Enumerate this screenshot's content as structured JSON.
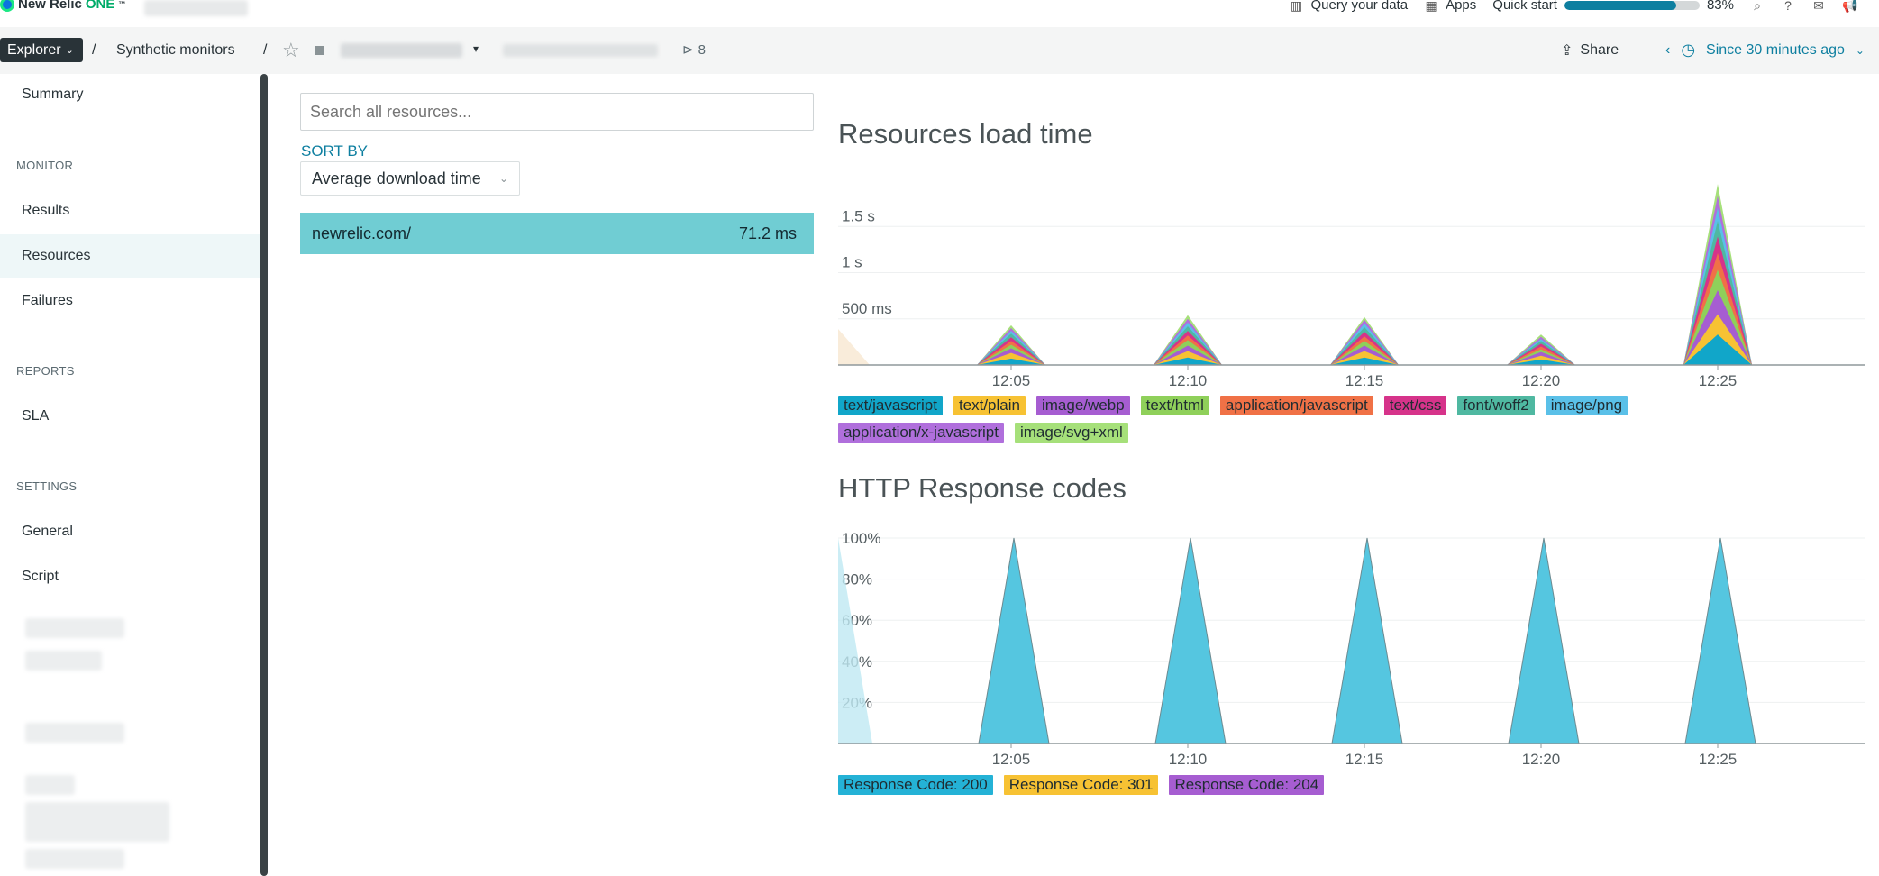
{
  "topnav": {
    "logo_text": "New Relic",
    "logo_one": "ONE",
    "logo_tm": "™",
    "query_label": "Query your data",
    "apps_label": "Apps",
    "quickstart_label": "Quick start",
    "quickstart_progress_pct": 83,
    "quickstart_progress_text": "83%",
    "icons": [
      "search-icon",
      "help-icon",
      "feedback-icon",
      "megaphone-icon"
    ]
  },
  "breadcrumb": {
    "explorer_label": "Explorer",
    "separator": "/",
    "section_label": "Synthetic monitors",
    "tag_count": "8",
    "share_label": "Share",
    "time_label": "Since 30 minutes ago"
  },
  "sidebar": {
    "summary": "Summary",
    "monitor_header": "MONITOR",
    "results": "Results",
    "resources": "Resources",
    "failures": "Failures",
    "reports_header": "REPORTS",
    "sla": "SLA",
    "settings_header": "SETTINGS",
    "general": "General",
    "script": "Script"
  },
  "resources": {
    "search_placeholder": "Search all resources...",
    "sort_by_label": "SORT BY",
    "sort_value": "Average download time",
    "rows": [
      {
        "name": "newrelic.com/",
        "value": "71.2 ms"
      }
    ]
  },
  "colors": {
    "accent": "#0e7fa0",
    "selected_row": "#70cdd3",
    "dark": "#293338"
  },
  "chart_data": [
    {
      "type": "area",
      "title": "Resources load time",
      "x": [
        "12:05",
        "12:10",
        "12:15",
        "12:20",
        "12:25"
      ],
      "y_ticks": [
        "500 ms",
        "1 s",
        "1.5 s"
      ],
      "ylim_ms": [
        0,
        2000
      ],
      "peak_totals_ms": [
        430,
        540,
        520,
        330,
        1960
      ],
      "series": [
        {
          "name": "text/javascript",
          "color": "#11a6c9",
          "values": [
            70,
            80,
            80,
            60,
            330
          ]
        },
        {
          "name": "text/plain",
          "color": "#f7c233",
          "values": [
            60,
            70,
            70,
            40,
            220
          ]
        },
        {
          "name": "image/webp",
          "color": "#a65dd1",
          "values": [
            50,
            60,
            60,
            40,
            260
          ]
        },
        {
          "name": "text/html",
          "color": "#8fd05a",
          "values": [
            40,
            60,
            50,
            30,
            220
          ]
        },
        {
          "name": "application/javascript",
          "color": "#f07146",
          "values": [
            40,
            50,
            50,
            30,
            180
          ]
        },
        {
          "name": "text/css",
          "color": "#d6338a",
          "values": [
            40,
            50,
            50,
            30,
            180
          ]
        },
        {
          "name": "font/woff2",
          "color": "#4fb8a1",
          "values": [
            40,
            50,
            50,
            30,
            170
          ]
        },
        {
          "name": "image/png",
          "color": "#5ac0e8",
          "values": [
            30,
            40,
            40,
            20,
            140
          ]
        },
        {
          "name": "application/x-javascript",
          "color": "#b06fdc",
          "values": [
            30,
            40,
            40,
            25,
            130
          ]
        },
        {
          "name": "image/svg+xml",
          "color": "#a6e07a",
          "values": [
            30,
            40,
            30,
            25,
            130
          ]
        }
      ]
    },
    {
      "type": "area",
      "title": "HTTP Response codes",
      "x": [
        "12:05",
        "12:10",
        "12:15",
        "12:20",
        "12:25"
      ],
      "y_ticks": [
        "20%",
        "40%",
        "60%",
        "80%",
        "100%"
      ],
      "ylim": [
        0,
        100
      ],
      "series": [
        {
          "name": "Response Code: 200",
          "color": "#24b2d6",
          "values": [
            100,
            100,
            100,
            100,
            100
          ]
        },
        {
          "name": "Response Code: 301",
          "color": "#f7c233",
          "values": [
            0,
            0,
            0,
            0,
            0
          ]
        },
        {
          "name": "Response Code: 204",
          "color": "#a65dd1",
          "values": [
            0,
            0,
            0,
            0,
            0
          ]
        }
      ]
    }
  ]
}
